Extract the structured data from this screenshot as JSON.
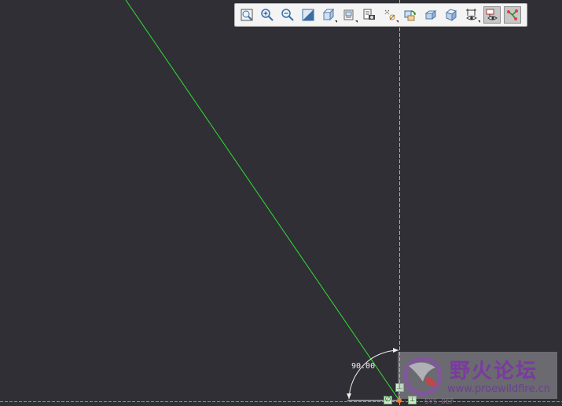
{
  "toolbar": {
    "buttons": [
      {
        "name": "refit-icon"
      },
      {
        "name": "zoom-in-icon"
      },
      {
        "name": "zoom-out-icon"
      },
      {
        "name": "repaint-icon"
      },
      {
        "name": "display-style-icon"
      },
      {
        "name": "saved-views-icon"
      },
      {
        "name": "view-manager-icon"
      },
      {
        "name": "layers-icon"
      },
      {
        "name": "datum-display-icon"
      },
      {
        "name": "spin-center-icon"
      },
      {
        "name": "annotation-display-icon"
      },
      {
        "name": "sketch-view-icon"
      },
      {
        "name": "dimension-display-icon"
      },
      {
        "name": "constraint-display-icon"
      },
      {
        "name": "vertex-display-icon"
      }
    ]
  },
  "sketch": {
    "angle_dimension": "90.00",
    "csys_label": "SYS_DEF",
    "colors": {
      "background": "#2f2f35",
      "line": "#33e033",
      "centerline": "#9aaed8",
      "dimension": "#f0f0f0"
    }
  },
  "watermark": {
    "title": "野火论坛",
    "url": "www.proewildfire.cn"
  }
}
